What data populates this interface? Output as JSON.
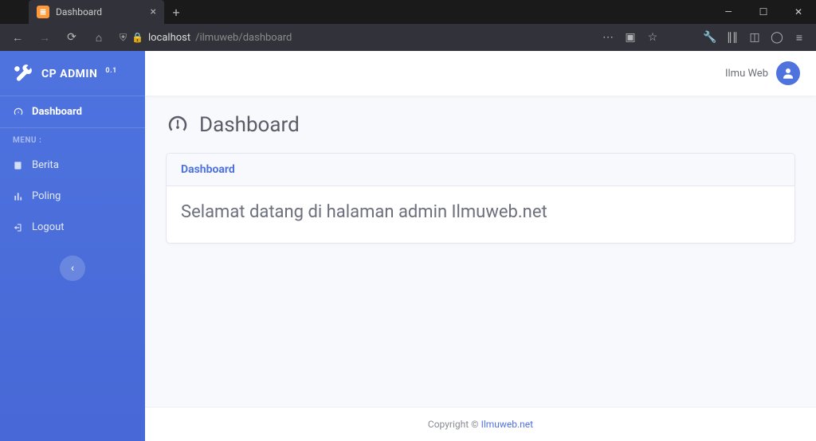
{
  "browser": {
    "tab_title": "Dashboard",
    "url_host": "localhost",
    "url_path": "/ilmuweb/dashboard"
  },
  "sidebar": {
    "brand": "CP ADMIN",
    "version": "0.1",
    "heading": "MENU :",
    "items": [
      {
        "label": "Dashboard"
      },
      {
        "label": "Berita"
      },
      {
        "label": "Poling"
      },
      {
        "label": "Logout"
      }
    ]
  },
  "topbar": {
    "username": "Ilmu Web"
  },
  "content": {
    "page_title": "Dashboard",
    "card_header": "Dashboard",
    "welcome": "Selamat datang di halaman admin Ilmuweb.net"
  },
  "footer": {
    "prefix": "Copyright © ",
    "link": "Ilmuweb.net"
  }
}
